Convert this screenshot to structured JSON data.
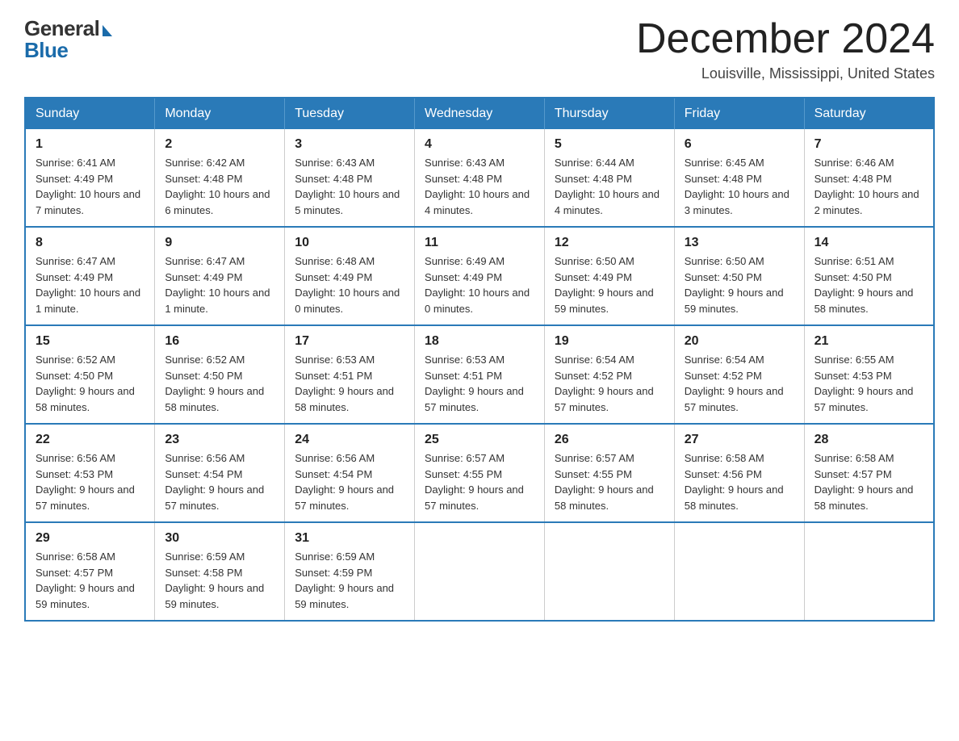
{
  "header": {
    "logo_general": "General",
    "logo_blue": "Blue",
    "month_title": "December 2024",
    "location": "Louisville, Mississippi, United States"
  },
  "days_of_week": [
    "Sunday",
    "Monday",
    "Tuesday",
    "Wednesday",
    "Thursday",
    "Friday",
    "Saturday"
  ],
  "weeks": [
    [
      {
        "day": "1",
        "sunrise": "6:41 AM",
        "sunset": "4:49 PM",
        "daylight": "10 hours and 7 minutes."
      },
      {
        "day": "2",
        "sunrise": "6:42 AM",
        "sunset": "4:48 PM",
        "daylight": "10 hours and 6 minutes."
      },
      {
        "day": "3",
        "sunrise": "6:43 AM",
        "sunset": "4:48 PM",
        "daylight": "10 hours and 5 minutes."
      },
      {
        "day": "4",
        "sunrise": "6:43 AM",
        "sunset": "4:48 PM",
        "daylight": "10 hours and 4 minutes."
      },
      {
        "day": "5",
        "sunrise": "6:44 AM",
        "sunset": "4:48 PM",
        "daylight": "10 hours and 4 minutes."
      },
      {
        "day": "6",
        "sunrise": "6:45 AM",
        "sunset": "4:48 PM",
        "daylight": "10 hours and 3 minutes."
      },
      {
        "day": "7",
        "sunrise": "6:46 AM",
        "sunset": "4:48 PM",
        "daylight": "10 hours and 2 minutes."
      }
    ],
    [
      {
        "day": "8",
        "sunrise": "6:47 AM",
        "sunset": "4:49 PM",
        "daylight": "10 hours and 1 minute."
      },
      {
        "day": "9",
        "sunrise": "6:47 AM",
        "sunset": "4:49 PM",
        "daylight": "10 hours and 1 minute."
      },
      {
        "day": "10",
        "sunrise": "6:48 AM",
        "sunset": "4:49 PM",
        "daylight": "10 hours and 0 minutes."
      },
      {
        "day": "11",
        "sunrise": "6:49 AM",
        "sunset": "4:49 PM",
        "daylight": "10 hours and 0 minutes."
      },
      {
        "day": "12",
        "sunrise": "6:50 AM",
        "sunset": "4:49 PM",
        "daylight": "9 hours and 59 minutes."
      },
      {
        "day": "13",
        "sunrise": "6:50 AM",
        "sunset": "4:50 PM",
        "daylight": "9 hours and 59 minutes."
      },
      {
        "day": "14",
        "sunrise": "6:51 AM",
        "sunset": "4:50 PM",
        "daylight": "9 hours and 58 minutes."
      }
    ],
    [
      {
        "day": "15",
        "sunrise": "6:52 AM",
        "sunset": "4:50 PM",
        "daylight": "9 hours and 58 minutes."
      },
      {
        "day": "16",
        "sunrise": "6:52 AM",
        "sunset": "4:50 PM",
        "daylight": "9 hours and 58 minutes."
      },
      {
        "day": "17",
        "sunrise": "6:53 AM",
        "sunset": "4:51 PM",
        "daylight": "9 hours and 58 minutes."
      },
      {
        "day": "18",
        "sunrise": "6:53 AM",
        "sunset": "4:51 PM",
        "daylight": "9 hours and 57 minutes."
      },
      {
        "day": "19",
        "sunrise": "6:54 AM",
        "sunset": "4:52 PM",
        "daylight": "9 hours and 57 minutes."
      },
      {
        "day": "20",
        "sunrise": "6:54 AM",
        "sunset": "4:52 PM",
        "daylight": "9 hours and 57 minutes."
      },
      {
        "day": "21",
        "sunrise": "6:55 AM",
        "sunset": "4:53 PM",
        "daylight": "9 hours and 57 minutes."
      }
    ],
    [
      {
        "day": "22",
        "sunrise": "6:56 AM",
        "sunset": "4:53 PM",
        "daylight": "9 hours and 57 minutes."
      },
      {
        "day": "23",
        "sunrise": "6:56 AM",
        "sunset": "4:54 PM",
        "daylight": "9 hours and 57 minutes."
      },
      {
        "day": "24",
        "sunrise": "6:56 AM",
        "sunset": "4:54 PM",
        "daylight": "9 hours and 57 minutes."
      },
      {
        "day": "25",
        "sunrise": "6:57 AM",
        "sunset": "4:55 PM",
        "daylight": "9 hours and 57 minutes."
      },
      {
        "day": "26",
        "sunrise": "6:57 AM",
        "sunset": "4:55 PM",
        "daylight": "9 hours and 58 minutes."
      },
      {
        "day": "27",
        "sunrise": "6:58 AM",
        "sunset": "4:56 PM",
        "daylight": "9 hours and 58 minutes."
      },
      {
        "day": "28",
        "sunrise": "6:58 AM",
        "sunset": "4:57 PM",
        "daylight": "9 hours and 58 minutes."
      }
    ],
    [
      {
        "day": "29",
        "sunrise": "6:58 AM",
        "sunset": "4:57 PM",
        "daylight": "9 hours and 59 minutes."
      },
      {
        "day": "30",
        "sunrise": "6:59 AM",
        "sunset": "4:58 PM",
        "daylight": "9 hours and 59 minutes."
      },
      {
        "day": "31",
        "sunrise": "6:59 AM",
        "sunset": "4:59 PM",
        "daylight": "9 hours and 59 minutes."
      },
      null,
      null,
      null,
      null
    ]
  ]
}
